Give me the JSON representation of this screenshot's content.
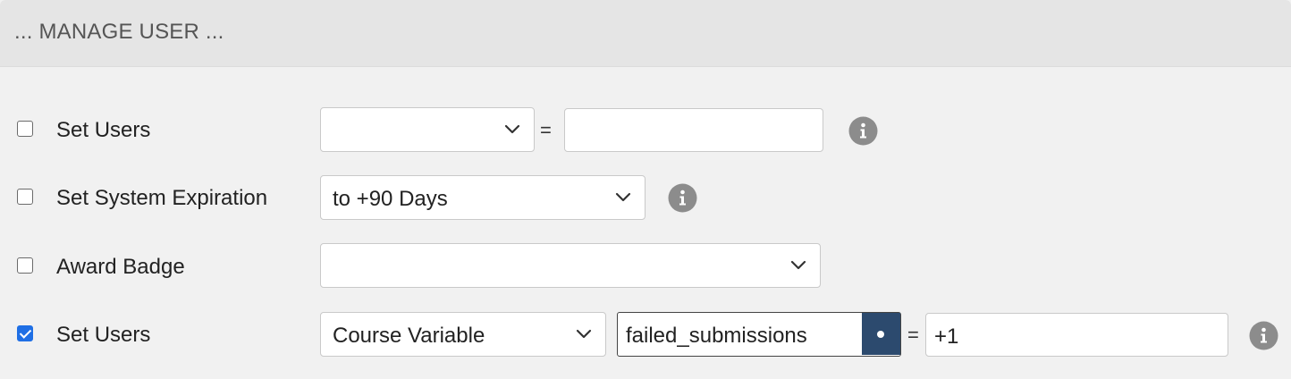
{
  "header": {
    "title": "... MANAGE USER ..."
  },
  "rows": [
    {
      "label": "Set Users",
      "checked": false,
      "select_value": "",
      "equals": "=",
      "input_value": "",
      "info_icon": "info-circle-icon"
    },
    {
      "label": "Set System Expiration",
      "checked": false,
      "select_value": "to +90 Days",
      "info_icon": "info-circle-icon"
    },
    {
      "label": "Award Badge",
      "checked": false,
      "select_value": ""
    },
    {
      "label": "Set Users",
      "checked": true,
      "select_value": "Course Variable",
      "variable_value": "failed_submissions",
      "addon_icon": "dot-icon",
      "equals": "=",
      "input_value": "+1",
      "info_icon": "info-circle-icon"
    }
  ],
  "colors": {
    "header_bg": "#e5e5e5",
    "panel_bg": "#f1f1f1",
    "checkbox_checked": "#1f6fe5",
    "addon_bg": "#2c4a6e",
    "info_icon": "#8c8c8c"
  }
}
